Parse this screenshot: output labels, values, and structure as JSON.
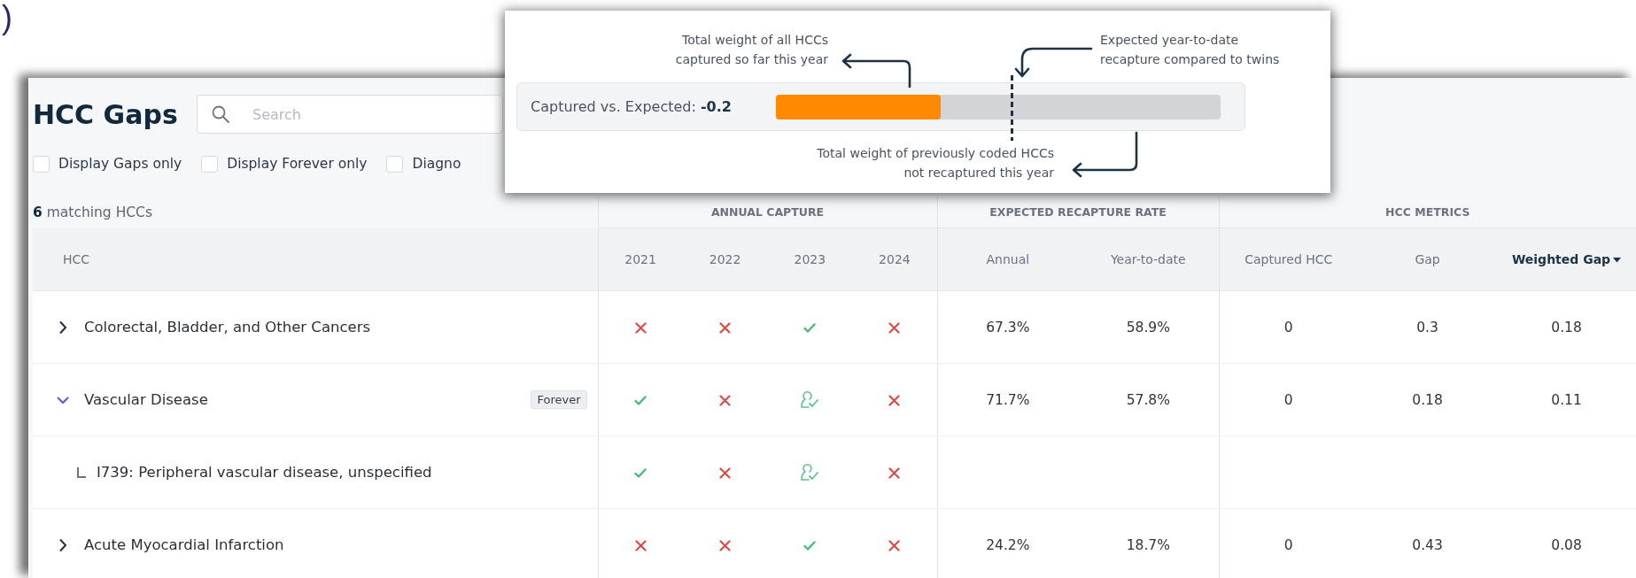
{
  "figure_label": ")",
  "app": {
    "title": "HCC Gaps",
    "search": {
      "placeholder": "Search"
    },
    "filters": [
      {
        "label": "Display Gaps only",
        "checked": false
      },
      {
        "label": "Display Forever only",
        "checked": false
      },
      {
        "label": "Diagno",
        "checked": false
      }
    ],
    "match_count": {
      "count": "6",
      "label": "matching HCCs"
    },
    "table": {
      "column_groups": [
        "ANNUAL CAPTURE",
        "EXPECTED RECAPTURE RATE",
        "HCC METRICS"
      ],
      "columns": [
        {
          "label": "HCC",
          "sorted": false
        },
        {
          "label": "2021",
          "sorted": false
        },
        {
          "label": "2022",
          "sorted": false
        },
        {
          "label": "2023",
          "sorted": false
        },
        {
          "label": "2024",
          "sorted": false
        },
        {
          "label": "Annual",
          "sorted": false
        },
        {
          "label": "Year-to-date",
          "sorted": false
        },
        {
          "label": "Captured HCC",
          "sorted": false
        },
        {
          "label": "Gap",
          "sorted": false
        },
        {
          "label": "Weighted Gap",
          "sorted": true
        }
      ],
      "rows": [
        {
          "name": "Colorectal, Bladder, and Other Cancers",
          "expanded": false,
          "capture": [
            {
              "kind": "cross"
            },
            {
              "kind": "cross"
            },
            {
              "kind": "check"
            },
            {
              "kind": "cross"
            }
          ],
          "annual": "67.3%",
          "ytd": "58.9%",
          "captured_hcc": "0",
          "gap": "0.3",
          "weighted_gap": "0.18"
        },
        {
          "name": "Vascular Disease",
          "expanded": true,
          "badge": "Forever",
          "capture": [
            {
              "kind": "check"
            },
            {
              "kind": "cross"
            },
            {
              "kind": "recapture"
            },
            {
              "kind": "cross"
            }
          ],
          "annual": "71.7%",
          "ytd": "57.8%",
          "captured_hcc": "0",
          "gap": "0.18",
          "weighted_gap": "0.11",
          "children": [
            {
              "name": "I739: Peripheral vascular disease, unspecified",
              "capture": [
                {
                  "kind": "check"
                },
                {
                  "kind": "cross"
                },
                {
                  "kind": "recapture"
                },
                {
                  "kind": "cross"
                }
              ]
            }
          ]
        },
        {
          "name": "Acute Myocardial Infarction",
          "expanded": false,
          "capture": [
            {
              "kind": "cross"
            },
            {
              "kind": "cross"
            },
            {
              "kind": "check"
            },
            {
              "kind": "cross"
            }
          ],
          "annual": "24.2%",
          "ytd": "18.7%",
          "captured_hcc": "0",
          "gap": "0.43",
          "weighted_gap": "0.08"
        }
      ]
    }
  },
  "callout": {
    "label": "Captured vs. Expected:",
    "value": "-0.2",
    "captured_bar": {
      "level": 0.37
    },
    "expected_marker": {
      "level": 0.53
    },
    "annotations": [
      {
        "kind": "captured",
        "text": "Total weight of all HCCs\ncaptured so far this year"
      },
      {
        "kind": "expected",
        "text": "Expected year-to-date\nrecapture compared to twins"
      },
      {
        "kind": "gap",
        "text": "Total weight of previously coded HCCs\nnot recaptured this year"
      }
    ]
  }
}
